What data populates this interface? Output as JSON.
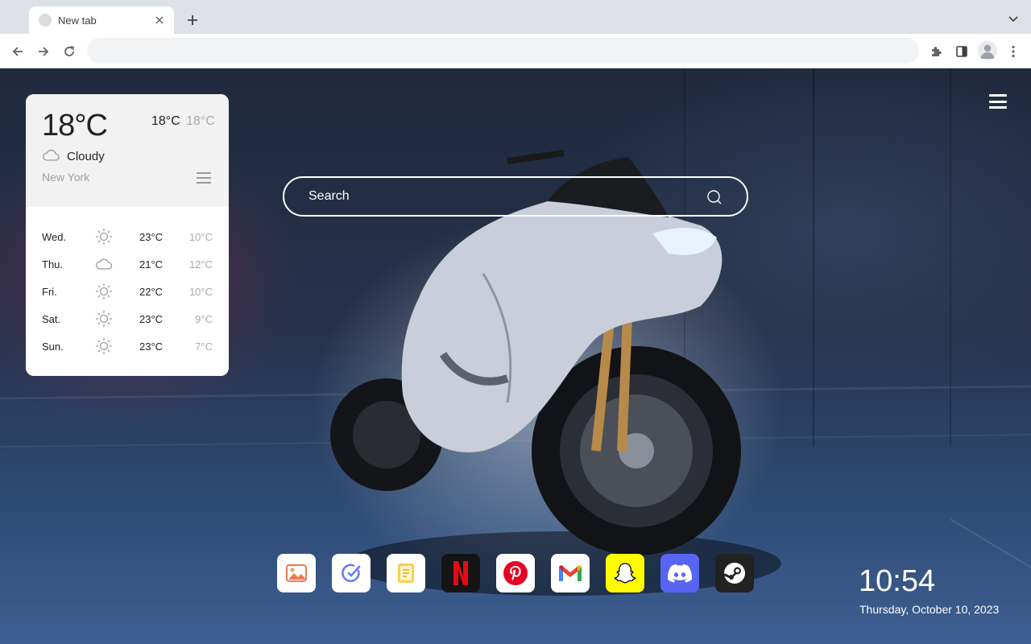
{
  "browser": {
    "tab_title": "New tab",
    "address_value": "",
    "address_placeholder": ""
  },
  "weather": {
    "current_temp": "18°C",
    "high": "18°C",
    "low": "18°C",
    "condition": "Cloudy",
    "city": "New York",
    "forecast": [
      {
        "day": "Wed.",
        "icon": "sun-icon",
        "high": "23°C",
        "low": "10°C"
      },
      {
        "day": "Thu.",
        "icon": "cloud-icon",
        "high": "21°C",
        "low": "12°C"
      },
      {
        "day": "Fri.",
        "icon": "sun-icon",
        "high": "22°C",
        "low": "10°C"
      },
      {
        "day": "Sat.",
        "icon": "sun-icon",
        "high": "23°C",
        "low": "9°C"
      },
      {
        "day": "Sun.",
        "icon": "sun-icon",
        "high": "23°C",
        "low": "7°C"
      }
    ]
  },
  "search": {
    "placeholder": "Search"
  },
  "dock": {
    "apps": [
      {
        "name": "wallpaper",
        "color": "#ffffff"
      },
      {
        "name": "tasks",
        "color": "#ffffff"
      },
      {
        "name": "notes",
        "color": "#ffffff"
      },
      {
        "name": "netflix",
        "color": "#141414"
      },
      {
        "name": "pinterest",
        "color": "#ffffff"
      },
      {
        "name": "gmail",
        "color": "#ffffff"
      },
      {
        "name": "snapchat",
        "color": "#fffc00"
      },
      {
        "name": "discord",
        "color": "#5865f2"
      },
      {
        "name": "steam",
        "color": "#222222"
      }
    ]
  },
  "clock": {
    "time": "10:54",
    "date": "Thursday, October 10, 2023"
  }
}
